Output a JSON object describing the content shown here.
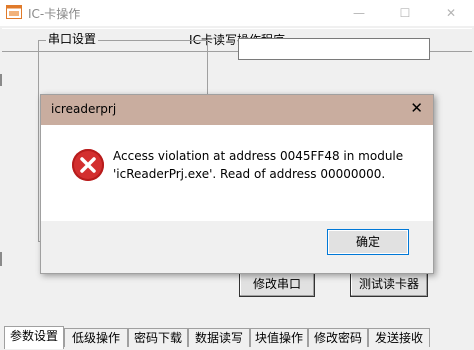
{
  "window": {
    "title": "IC-卡操作",
    "controls": {
      "minimize": "—",
      "maximize": "☐",
      "close": "✕"
    }
  },
  "header": {
    "title": "IC卡读写操作程序"
  },
  "main": {
    "groupbox_title": "串口设置",
    "modify_port_button": "修改串口",
    "test_reader_button": "测试读卡器"
  },
  "tabs": [
    {
      "label": "参数设置",
      "active": true
    },
    {
      "label": "低级操作"
    },
    {
      "label": "密码下载"
    },
    {
      "label": "数据读写"
    },
    {
      "label": "块值操作"
    },
    {
      "label": "修改密码"
    },
    {
      "label": "发送接收"
    }
  ],
  "dialog": {
    "title": "icreaderprj",
    "close_icon": "✕",
    "message_lines": [
      "Access violation at address 0045FF48 in module",
      "'icReaderPrj.exe'. Read of address 00000000."
    ],
    "ok_button": "确定",
    "icon": "error-icon"
  }
}
